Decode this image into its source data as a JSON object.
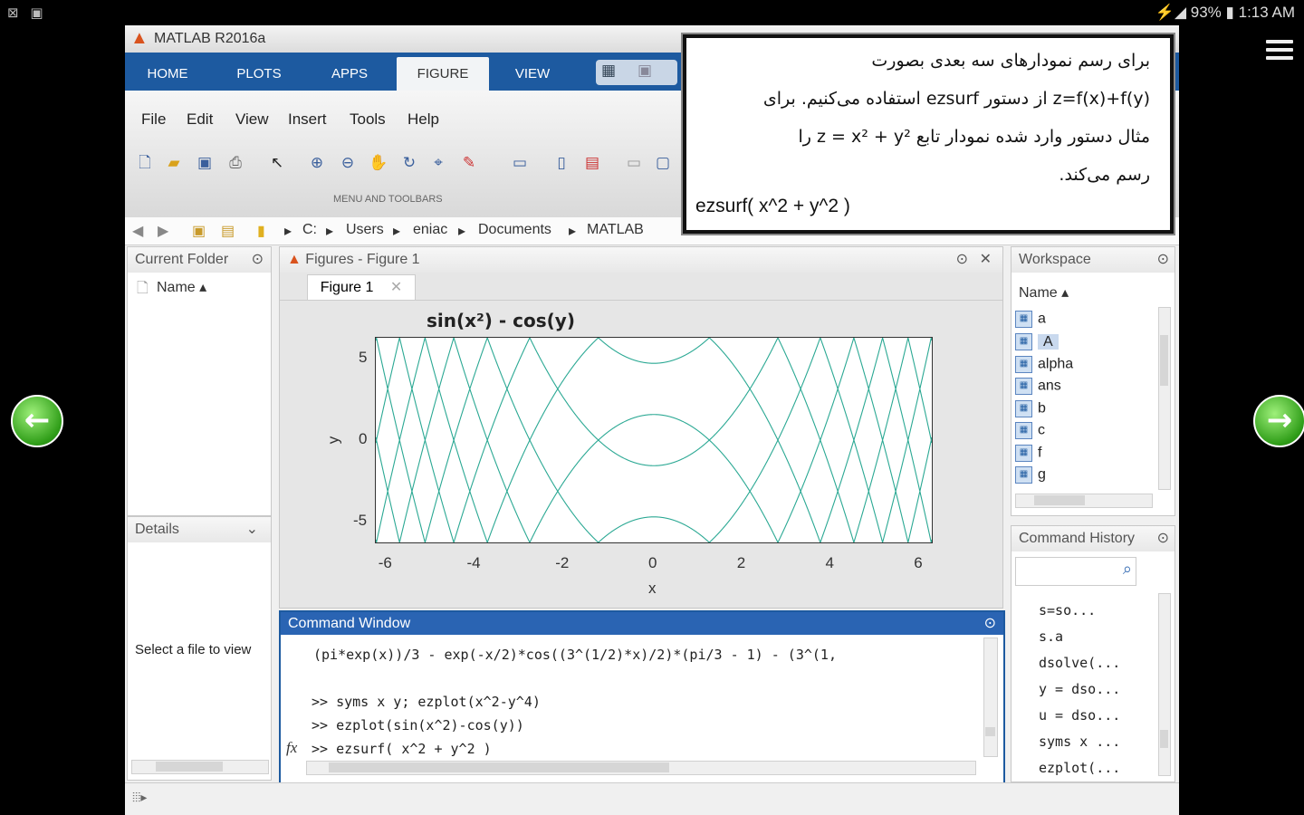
{
  "status_bar": {
    "battery": "93%",
    "time": "1:13 AM"
  },
  "app": {
    "title": "MATLAB R2016a"
  },
  "ribbon_tabs": [
    "HOME",
    "PLOTS",
    "APPS",
    "FIGURE",
    "VIEW"
  ],
  "active_tab": "FIGURE",
  "menu": [
    "File",
    "Edit",
    "View",
    "Insert",
    "Tools",
    "Help"
  ],
  "toolbar_group_label": "MENU AND TOOLBARS",
  "address": [
    "C:",
    "Users",
    "eniac",
    "Documents",
    "MATLAB"
  ],
  "current_folder": {
    "title": "Current Folder",
    "column": "Name"
  },
  "details": {
    "title": "Details",
    "message": "Select a file to view"
  },
  "figures": {
    "title": "Figures - Figure 1",
    "tab": "Figure 1"
  },
  "chart_data": {
    "type": "line",
    "title": "sin(x²) - cos(y)",
    "xlabel": "x",
    "ylabel": "y",
    "xlim": [
      -6.28,
      6.28
    ],
    "ylim": [
      -6.28,
      6.28
    ],
    "x_ticks": [
      -6,
      -4,
      -2,
      0,
      2,
      4,
      6
    ],
    "y_ticks": [
      -5,
      0,
      5
    ],
    "function": "sin(x^2) - cos(y) = 0",
    "line_color": "#2aa893"
  },
  "command_window": {
    "title": "Command Window",
    "lines": [
      "(pi*exp(x))/3 - exp(-x/2)*cos((3^(1/2)*x)/2)*(pi/3 - 1) - (3^(1,",
      "",
      ">> syms x y; ezplot(x^2-y^4)",
      ">> ezplot(sin(x^2)-cos(y))",
      ">> ezsurf( x^2 + y^2 )"
    ],
    "prompt_icon": "fx"
  },
  "workspace": {
    "title": "Workspace",
    "column": "Name",
    "items": [
      "a",
      "A",
      "alpha",
      "ans",
      "b",
      "c",
      "f",
      "g"
    ],
    "selected": "A"
  },
  "history": {
    "title": "Command History",
    "items": [
      "s=so...",
      "s.a",
      "dsolve(...",
      "y = dso...",
      "u = dso...",
      "syms x ...",
      "ezplot(..."
    ]
  },
  "overlay": {
    "lines": [
      "برای رسم نمودارهای سه بعدی بصورت",
      "z=f(x)+f(y) از دستور ezsurf استفاده می‌کنیم. برای",
      "مثال دستور وارد شده نمودار تابع z = x² + y² را",
      "رسم می‌کند."
    ],
    "command": "ezsurf( x^2 + y^2 )"
  }
}
